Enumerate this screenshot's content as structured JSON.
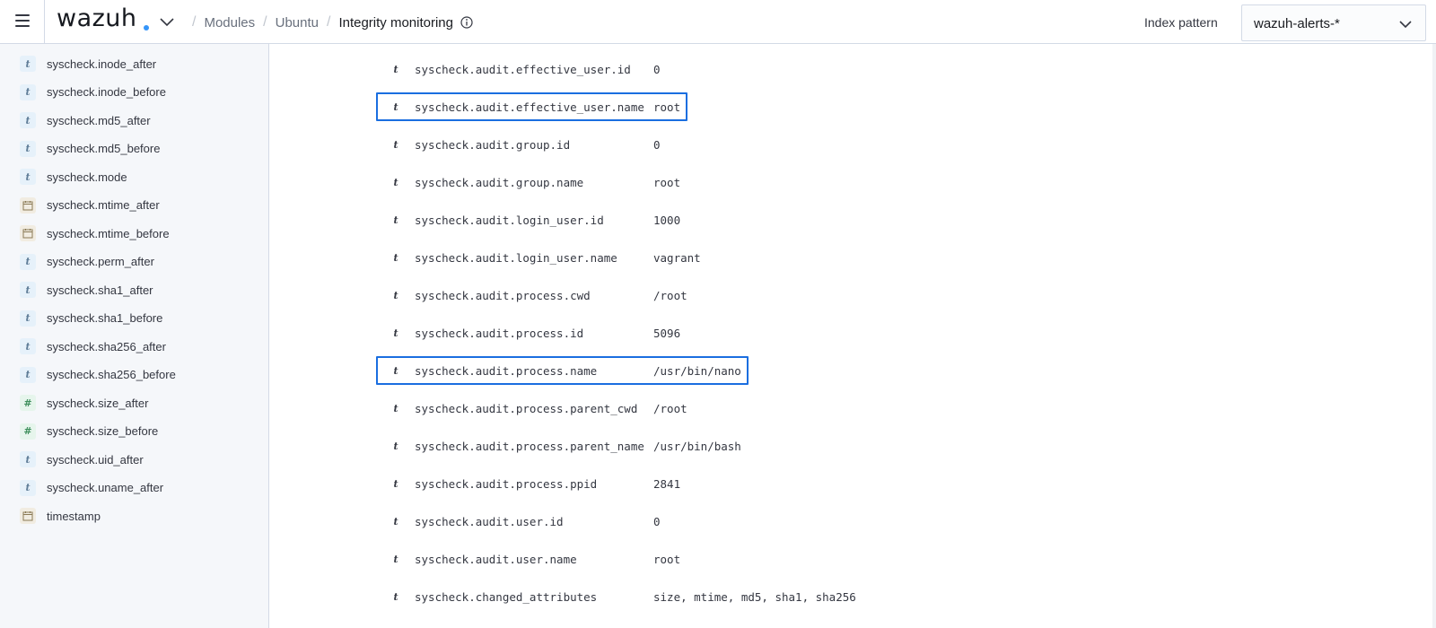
{
  "header": {
    "logo_text": "wazuh",
    "breadcrumbs": [
      "Modules",
      "Ubuntu",
      "Integrity monitoring"
    ],
    "index_pattern_label": "Index pattern",
    "index_pattern_value": "wazuh-alerts-*",
    "icons": [
      "menu-icon",
      "chevron-down-icon",
      "info-icon"
    ]
  },
  "sidebar": {
    "fields": [
      {
        "type": "t",
        "name": "syscheck.inode_after"
      },
      {
        "type": "t",
        "name": "syscheck.inode_before"
      },
      {
        "type": "t",
        "name": "syscheck.md5_after"
      },
      {
        "type": "t",
        "name": "syscheck.md5_before"
      },
      {
        "type": "t",
        "name": "syscheck.mode"
      },
      {
        "type": "date",
        "name": "syscheck.mtime_after"
      },
      {
        "type": "date",
        "name": "syscheck.mtime_before"
      },
      {
        "type": "t",
        "name": "syscheck.perm_after"
      },
      {
        "type": "t",
        "name": "syscheck.sha1_after"
      },
      {
        "type": "t",
        "name": "syscheck.sha1_before"
      },
      {
        "type": "t",
        "name": "syscheck.sha256_after"
      },
      {
        "type": "t",
        "name": "syscheck.sha256_before"
      },
      {
        "type": "#",
        "name": "syscheck.size_after"
      },
      {
        "type": "#",
        "name": "syscheck.size_before"
      },
      {
        "type": "t",
        "name": "syscheck.uid_after"
      },
      {
        "type": "t",
        "name": "syscheck.uname_after"
      },
      {
        "type": "date",
        "name": "timestamp"
      }
    ]
  },
  "document": {
    "rows": [
      {
        "type": "t",
        "key": "syscheck.audit.effective_user.id",
        "value": "0",
        "highlighted": false
      },
      {
        "type": "t",
        "key": "syscheck.audit.effective_user.name",
        "value": "root",
        "highlighted": true
      },
      {
        "type": "t",
        "key": "syscheck.audit.group.id",
        "value": "0",
        "highlighted": false
      },
      {
        "type": "t",
        "key": "syscheck.audit.group.name",
        "value": "root",
        "highlighted": false
      },
      {
        "type": "t",
        "key": "syscheck.audit.login_user.id",
        "value": "1000",
        "highlighted": false
      },
      {
        "type": "t",
        "key": "syscheck.audit.login_user.name",
        "value": "vagrant",
        "highlighted": false
      },
      {
        "type": "t",
        "key": "syscheck.audit.process.cwd",
        "value": "/root",
        "highlighted": false
      },
      {
        "type": "t",
        "key": "syscheck.audit.process.id",
        "value": "5096",
        "highlighted": false
      },
      {
        "type": "t",
        "key": "syscheck.audit.process.name",
        "value": "/usr/bin/nano",
        "highlighted": true
      },
      {
        "type": "t",
        "key": "syscheck.audit.process.parent_cwd",
        "value": "/root",
        "highlighted": false
      },
      {
        "type": "t",
        "key": "syscheck.audit.process.parent_name",
        "value": "/usr/bin/bash",
        "highlighted": false
      },
      {
        "type": "t",
        "key": "syscheck.audit.process.ppid",
        "value": "2841",
        "highlighted": false
      },
      {
        "type": "t",
        "key": "syscheck.audit.user.id",
        "value": "0",
        "highlighted": false
      },
      {
        "type": "t",
        "key": "syscheck.audit.user.name",
        "value": "root",
        "highlighted": false
      },
      {
        "type": "t",
        "key": "syscheck.changed_attributes",
        "value": "size, mtime, md5, sha1, sha256",
        "highlighted": false
      }
    ]
  },
  "colors": {
    "accent": "#3595f9",
    "highlight_border": "#1a6ee0",
    "sidebar_bg": "#f5f7fa"
  }
}
